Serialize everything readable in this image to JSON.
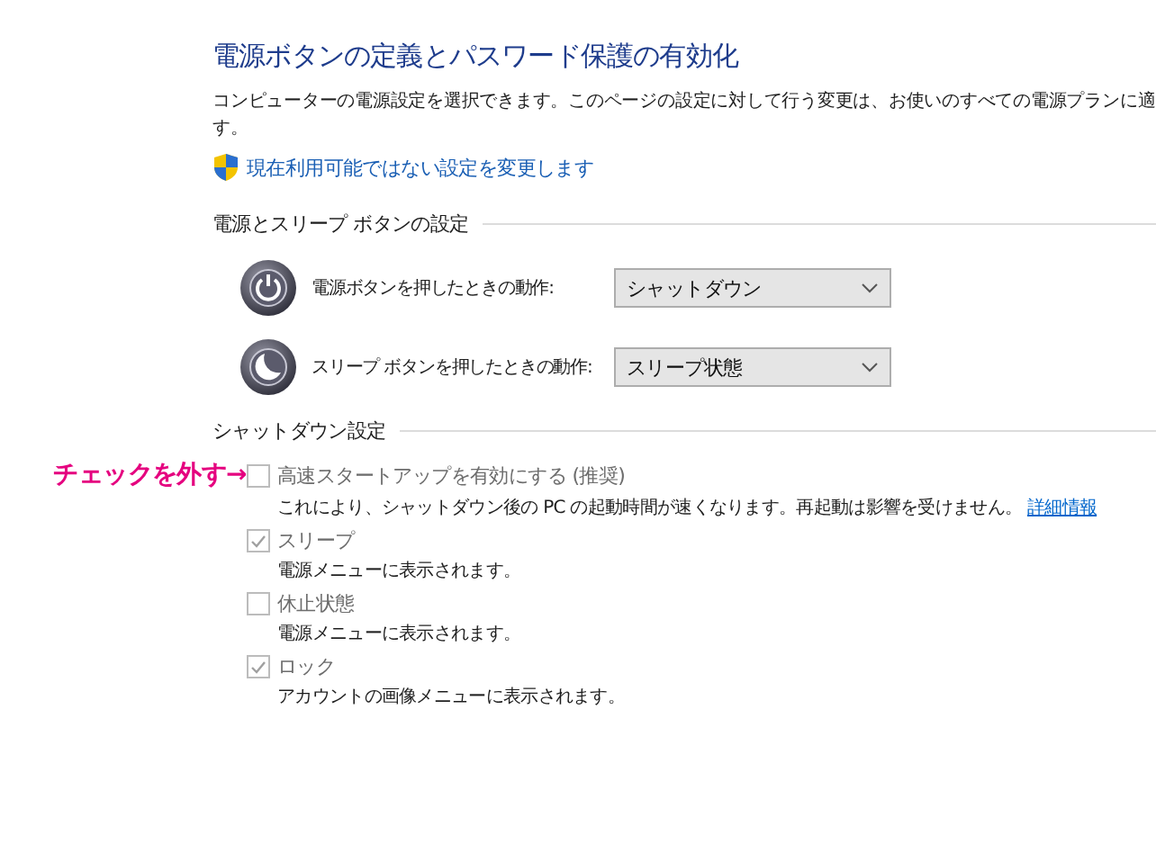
{
  "title": "電源ボタンの定義とパスワード保護の有効化",
  "description_lines": [
    "コンピューターの電源設定を選択できます。このページの設定に対して行う変更は、お使いのすべての電源プランに適",
    "す。"
  ],
  "admin_link": {
    "text": "現在利用可能ではない設定を変更します"
  },
  "buttons_section": {
    "heading": "電源とスリープ ボタンの設定",
    "rows": [
      {
        "kind": "power",
        "label": "電源ボタンを押したときの動作:",
        "value": "シャットダウン"
      },
      {
        "kind": "sleep",
        "label": "スリープ ボタンを押したときの動作:",
        "value": "スリープ状態"
      }
    ]
  },
  "shutdown_section": {
    "heading": "シャットダウン設定",
    "items": [
      {
        "label": "高速スタートアップを有効にする (推奨)",
        "checked": false,
        "disabled": true,
        "description": "これにより、シャットダウン後の PC の起動時間が速くなります。再起動は影響を受けません。",
        "link": "詳細情報",
        "annotation": "チェックを外す→"
      },
      {
        "label": "スリープ",
        "checked": true,
        "disabled": true,
        "description": "電源メニューに表示されます。"
      },
      {
        "label": "休止状態",
        "checked": false,
        "disabled": true,
        "description": "電源メニューに表示されます。"
      },
      {
        "label": "ロック",
        "checked": true,
        "disabled": true,
        "description": "アカウントの画像メニューに表示されます。"
      }
    ]
  }
}
